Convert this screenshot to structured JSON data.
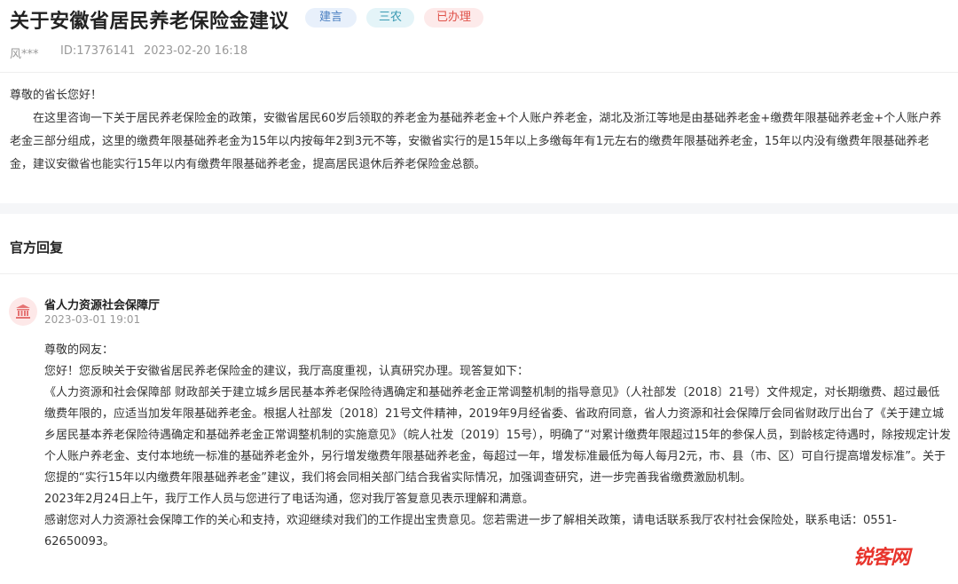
{
  "header": {
    "title": "关于安徽省居民养老保险金建议",
    "tags": [
      "建言",
      "三农",
      "已办理"
    ],
    "author": "风***",
    "id_label": "ID:17376141",
    "datetime": "2023-02-20 16:18"
  },
  "letter": {
    "greeting": "尊敬的省长您好！",
    "body": "在这里咨询一下关于居民养老保险金的政策，安徽省居民60岁后领取的养老金为基础养老金+个人账户养老金，湖北及浙江等地是由基础养老金+缴费年限基础养老金+个人账户养老金三部分组成，这里的缴费年限基础养老金为15年以内按每年2到3元不等，安徽省实行的是15年以上多缴每年有1元左右的缴费年限基础养老金，15年以内没有缴费年限基础养老金，建议安徽省也能实行15年以内有缴费年限基础养老金，提高居民退休后养老保险金总额。"
  },
  "reply": {
    "section_title": "官方回复",
    "org_name": "省人力资源社会保障厅",
    "datetime": "2023-03-01 19:01",
    "paragraphs": [
      "尊敬的网友：",
      "您好！您反映关于安徽省居民养老保险金的建议，我厅高度重视，认真研究办理。现答复如下：",
      "《人力资源和社会保障部 财政部关于建立城乡居民基本养老保险待遇确定和基础养老金正常调整机制的指导意见》（人社部发〔2018〕21号）文件规定，对长期缴费、超过最低缴费年限的，应适当加发年限基础养老金。根据人社部发〔2018〕21号文件精神，2019年9月经省委、省政府同意，省人力资源和社会保障厅会同省财政厅出台了《关于建立城乡居民基本养老保险待遇确定和基础养老金正常调整机制的实施意见》（皖人社发〔2019〕15号），明确了“对累计缴费年限超过15年的参保人员，到龄核定待遇时，除按规定计发个人账户养老金、支付本地统一标准的基础养老金外，另行增发缴费年限基础养老金，每超过一年，增发标准最低为每人每月2元，市、县（市、区）可自行提高增发标准”。关于您提的“实行15年以内缴费年限基础养老金”建议，我们将会同相关部门结合我省实际情况，加强调查研究，进一步完善我省缴费激励机制。",
      "2023年2月24日上午，我厅工作人员与您进行了电话沟通，您对我厅答复意见表示理解和满意。",
      "感谢您对人力资源社会保障工作的关心和支持，欢迎继续对我们的工作提出宝贵意见。您若需进一步了解相关政策，请电话联系我厅农村社会保险处，联系电话：0551-62650093。"
    ]
  },
  "watermark": "锐客网",
  "colors": {
    "tag_blue": "#4a7fc1",
    "tag_cyan": "#3a9ab3",
    "tag_red": "#e0534a",
    "watermark_red": "#e8342c"
  }
}
